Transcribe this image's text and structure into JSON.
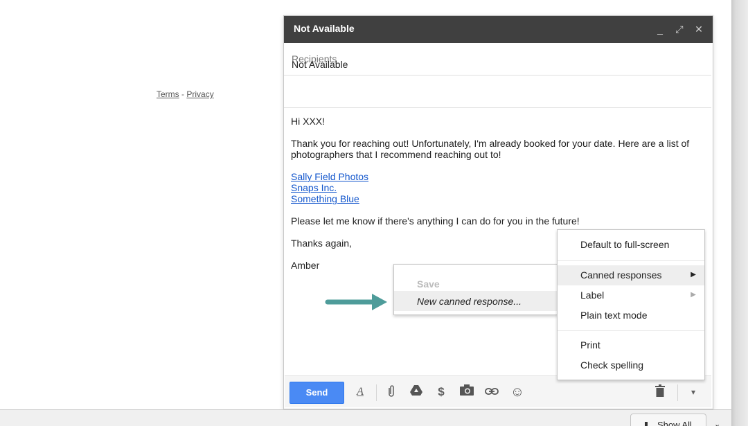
{
  "footer": {
    "terms": "Terms",
    "separator": "-",
    "privacy": "Privacy"
  },
  "compose": {
    "title": "Not Available",
    "header_icons": [
      "minimize-icon",
      "expand-icon",
      "close-icon"
    ],
    "header_glyphs": {
      "minimize": "_",
      "expand": "⤢",
      "close": "✕"
    },
    "recipients_placeholder": "Recipients",
    "subject": "Not Available",
    "body": {
      "greeting": "Hi XXX!",
      "paragraph1": "Thank you for reaching out! Unfortunately, I'm already booked for your date. Here are a list of photographers that I recommend reaching out to!",
      "links": [
        "Sally Field Photos",
        "Snaps Inc.",
        "Something Blue"
      ],
      "paragraph2": "Please let me know if there's anything I can do for you in the future!",
      "closing": "Thanks again,",
      "signature": "Amber"
    },
    "link_color": "#1155cc"
  },
  "toolbar": {
    "send_label": "Send",
    "send_color": "#4a8af4",
    "icons": {
      "formatting": "A",
      "attach": "📎",
      "drive": "▲",
      "money": "$",
      "photo": "📷",
      "link": "⊂⊃",
      "emoji": "☺",
      "trash": "🗑",
      "more": "▾"
    }
  },
  "main_menu": {
    "items": [
      {
        "label": "Default to full-screen"
      },
      {
        "label": "Canned responses",
        "has_submenu": true,
        "highlighted": true
      },
      {
        "label": "Label",
        "has_submenu": true
      },
      {
        "label": "Plain text mode"
      },
      {
        "label": "Print"
      },
      {
        "label": "Check spelling"
      }
    ],
    "arrow": "▶"
  },
  "sub_menu": {
    "items": [
      {
        "label": "Save",
        "disabled": true
      },
      {
        "label": "New canned response...",
        "highlighted": true
      }
    ]
  },
  "annotation": {
    "arrow_color": "#4e9c9a"
  },
  "download_shelf": {
    "show_all_label": "Show All",
    "chevron": "⌄"
  }
}
